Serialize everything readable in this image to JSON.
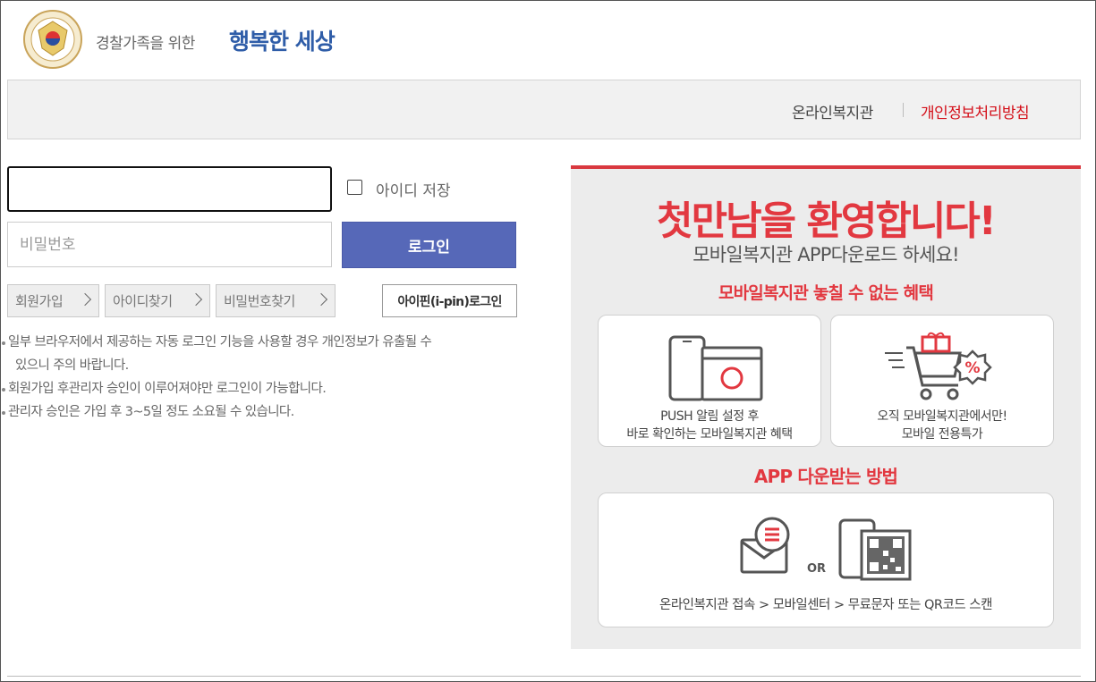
{
  "header": {
    "logo_sub": "경찰가족을 위한",
    "logo_main": "행복한 세상"
  },
  "nav": {
    "online_welfare": "온라인복지관",
    "privacy_policy": "개인정보처리방침"
  },
  "login": {
    "id_value": "",
    "id_placeholder": "",
    "save_id_label": "아이디 저장",
    "password_placeholder": "비밀번호",
    "login_button": "로그인",
    "signup_button": "회원가입",
    "find_id_button": "아이디찾기",
    "find_password_button": "비밀번호찾기",
    "ipin_button": "아이핀(i-pin)로그인"
  },
  "notes": {
    "note1_line1": "일부 브라우저에서 제공하는 자동 로그인 기능을 사용할 경우 개인정보가 유출될 수",
    "note1_line2": "있으니 주의 바랍니다.",
    "note2": "회원가입 후관리자 승인이 이루어져야만 로그인이 가능합니다.",
    "note3": "관리자 승인은 가입 후 3~5일 정도 소요될 수 있습니다."
  },
  "promo": {
    "title": "첫만남을 환영합니다!",
    "subtitle": "모바일복지관 APP다운로드 하세요!",
    "benefits_heading": "모바일복지관 놓칠 수 없는 혜택",
    "card1_line1": "PUSH 알림 설정 후",
    "card1_line2": "바로 확인하는 모바일복지관 혜택",
    "card2_line1": "오직 모바일복지관에서만!",
    "card2_line2": "모바일 전용특가",
    "download_heading": "APP 다운받는 방법",
    "or_label": "OR",
    "steps_text": "온라인복지관 접속 > 모바일센터 > 무료문자 또는 QR코드 스캔",
    "accent_color": "#e23840"
  },
  "icons": [
    "police-emblem-icon",
    "checkbox-icon",
    "chevron-right-icon",
    "smartphone-icon",
    "shopping-cart-icon",
    "discount-badge-icon",
    "gift-icon",
    "envelope-icon",
    "message-bubble-icon",
    "qr-code-icon"
  ]
}
